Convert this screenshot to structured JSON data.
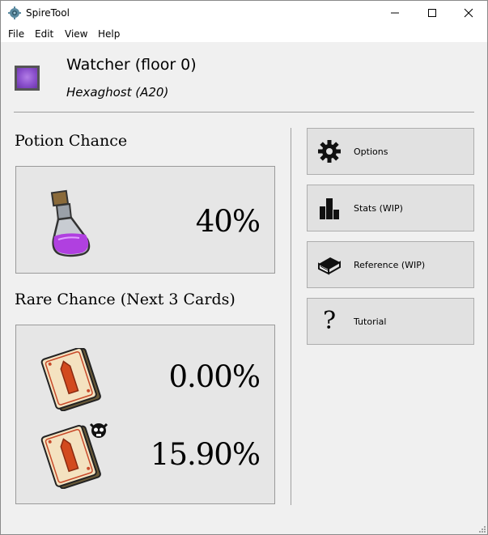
{
  "window": {
    "title": "SpireTool",
    "icons": {
      "app": "gear-app-icon",
      "minimize": "minimize-icon",
      "maximize": "maximize-icon",
      "close": "close-icon"
    }
  },
  "menu": [
    "File",
    "Edit",
    "View",
    "Help"
  ],
  "character": {
    "name": "Watcher (floor 0)",
    "boss": "Hexaghost (A20)",
    "color": "#8a4fcc"
  },
  "potion": {
    "title": "Potion Chance",
    "value": "40%",
    "icon": "potion-flask-icon",
    "liquid_color": "#b040e0"
  },
  "rare": {
    "title": "Rare Chance (Next 3 Cards)",
    "rows": [
      {
        "value": "0.00%",
        "icon": "rare-card-icon"
      },
      {
        "value": "15.90%",
        "icon": "rare-card-with-skull-icon"
      }
    ]
  },
  "buttons": [
    {
      "label": "Options",
      "icon": "gear-icon"
    },
    {
      "label": "Stats (WIP)",
      "icon": "bar-chart-icon"
    },
    {
      "label": "Reference (WIP)",
      "icon": "book-icon"
    },
    {
      "label": "Tutorial",
      "icon": "question-mark-icon"
    }
  ]
}
